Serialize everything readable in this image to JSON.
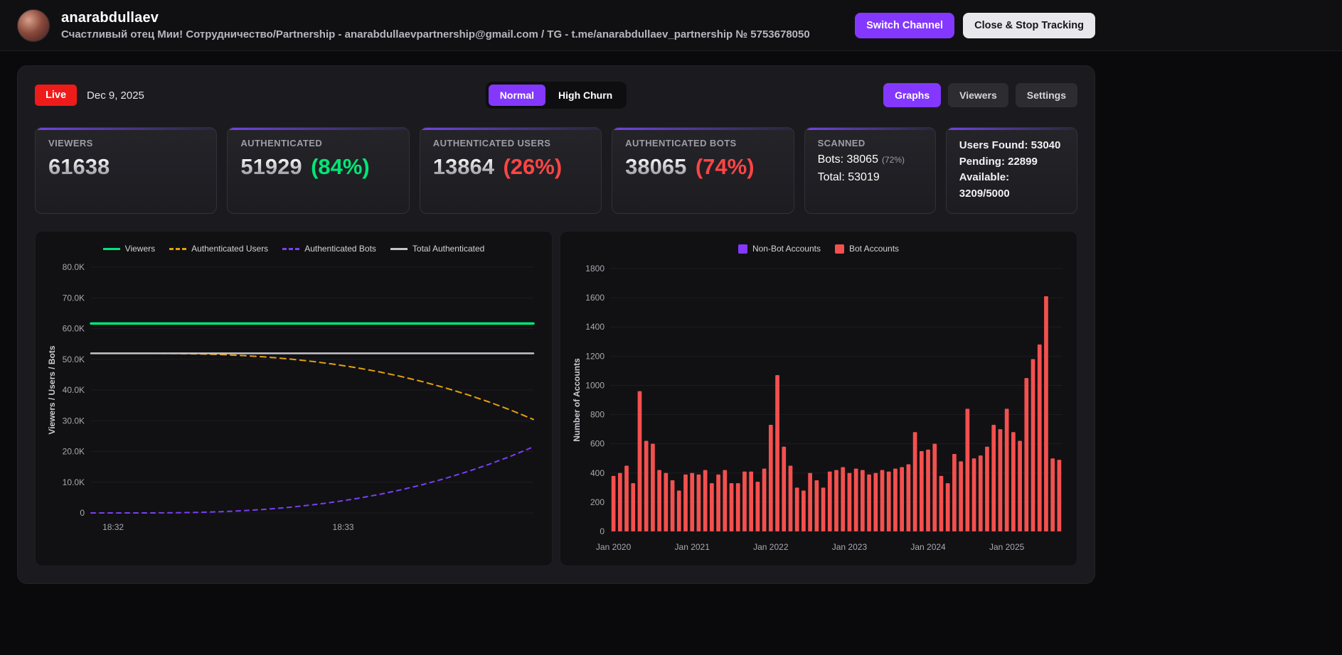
{
  "colors": {
    "accent_purple": "#8438ff",
    "live_red": "#ee1b1b",
    "positive_green": "#00e676",
    "negative_red": "#ff4545",
    "bar_red": "#f4504e"
  },
  "header": {
    "username": "anarabdullaev",
    "subtitle": "Счастливый отец Мии! Сотрудничество/Partnership - anarabdullaevpartnership@gmail.com / TG - t.me/anarabdullaev_partnership № 5753678050",
    "buttons": {
      "switch_channel": "Switch Channel",
      "close_tracking": "Close & Stop Tracking"
    }
  },
  "toolbar": {
    "live_label": "Live",
    "date": "Dec 9, 2025",
    "modes": {
      "normal": "Normal",
      "high_churn": "High Churn"
    },
    "tabs": {
      "graphs": "Graphs",
      "viewers": "Viewers",
      "settings": "Settings"
    }
  },
  "stats": {
    "viewers": {
      "label": "VIEWERS",
      "value": "61638"
    },
    "authenticated": {
      "label": "AUTHENTICATED",
      "value": "51929",
      "percent": "(84%)"
    },
    "users": {
      "label": "AUTHENTICATED USERS",
      "value": "13864",
      "percent": "(26%)"
    },
    "bots": {
      "label": "AUTHENTICATED BOTS",
      "value": "38065",
      "percent": "(74%)"
    },
    "scanned": {
      "label": "SCANNED",
      "bots": "Bots: 38065",
      "bots_pct": "(72%)",
      "total": "Total: 53019"
    },
    "summary": {
      "users_found": "Users Found: 53040",
      "pending": "Pending: 22899",
      "available_label": "Available:",
      "available_value": "3209/5000"
    }
  },
  "chart_data": [
    {
      "type": "line",
      "title": "",
      "xlabel": "",
      "ylabel": "Viewers / Users / Bots",
      "ylim": [
        0,
        80000
      ],
      "grid": false,
      "legend_position": "top",
      "yticks": [
        0,
        10000,
        20000,
        30000,
        40000,
        50000,
        60000,
        70000,
        80000
      ],
      "ytick_labels": [
        "0",
        "10.0K",
        "20.0K",
        "30.0K",
        "40.0K",
        "50.0K",
        "60.0K",
        "70.0K",
        "80.0K"
      ],
      "xticks": [
        {
          "pos": 0.05,
          "label": "18:32"
        },
        {
          "pos": 0.57,
          "label": "18:33"
        }
      ],
      "series": [
        {
          "name": "Viewers",
          "color": "#00e676",
          "width": 3.5,
          "dash": null,
          "values": [
            61638,
            61638,
            61638,
            61638,
            61638,
            61638,
            61638,
            61638,
            61638,
            61638,
            61638,
            61638,
            61638,
            61638,
            61638,
            61638,
            61638,
            61638,
            61638,
            61638,
            61638
          ]
        },
        {
          "name": "Authenticated Users",
          "color": "#e5a00d",
          "width": 2,
          "dash": "8 6",
          "values": [
            51929,
            51929,
            51929,
            51917,
            51858,
            51725,
            51498,
            51159,
            50695,
            50084,
            49322,
            48381,
            47265,
            45957,
            44434,
            42703,
            40739,
            38539,
            36099,
            33399,
            30429
          ]
        },
        {
          "name": "Authenticated Bots",
          "color": "#7b3ff2",
          "width": 2,
          "dash": "6 6",
          "values": [
            0,
            0,
            0,
            12,
            71,
            204,
            431,
            770,
            1234,
            1845,
            2607,
            3548,
            4664,
            5972,
            7495,
            9226,
            11190,
            13390,
            15830,
            18530,
            21500
          ]
        },
        {
          "name": "Total Authenticated",
          "color": "#c4c4ca",
          "width": 2.5,
          "dash": null,
          "values": [
            51929,
            51929,
            51929,
            51929,
            51929,
            51929,
            51929,
            51929,
            51929,
            51929,
            51929,
            51929,
            51929,
            51929,
            51929,
            51929,
            51929,
            51929,
            51929,
            51929,
            51929
          ]
        }
      ]
    },
    {
      "type": "bar",
      "title": "",
      "xlabel": "",
      "ylabel": "Number of Accounts",
      "ylim": [
        0,
        1800
      ],
      "grid": false,
      "legend_position": "top",
      "yticks": [
        0,
        200,
        400,
        600,
        800,
        1000,
        1200,
        1400,
        1600,
        1800
      ],
      "n_bars": 69,
      "xticks": [
        {
          "index": 0,
          "label": "Jan 2020"
        },
        {
          "index": 12,
          "label": "Jan 2021"
        },
        {
          "index": 24,
          "label": "Jan 2022"
        },
        {
          "index": 36,
          "label": "Jan 2023"
        },
        {
          "index": 48,
          "label": "Jan 2024"
        },
        {
          "index": 60,
          "label": "Jan 2025"
        }
      ],
      "series": [
        {
          "name": "Non-Bot Accounts",
          "color": "#8438ff",
          "values": []
        },
        {
          "name": "Bot Accounts",
          "color": "#f4504e",
          "values": [
            380,
            400,
            450,
            330,
            960,
            620,
            600,
            420,
            400,
            350,
            280,
            390,
            400,
            390,
            420,
            330,
            390,
            420,
            330,
            330,
            410,
            410,
            340,
            430,
            730,
            1070,
            580,
            450,
            300,
            280,
            400,
            350,
            300,
            410,
            420,
            440,
            400,
            430,
            420,
            390,
            400,
            420,
            410,
            430,
            440,
            460,
            680,
            550,
            560,
            600,
            380,
            330,
            530,
            480,
            840,
            500,
            520,
            580,
            730,
            700,
            840,
            680,
            620,
            1050,
            1180,
            1280,
            1610,
            500,
            490
          ]
        }
      ]
    }
  ]
}
